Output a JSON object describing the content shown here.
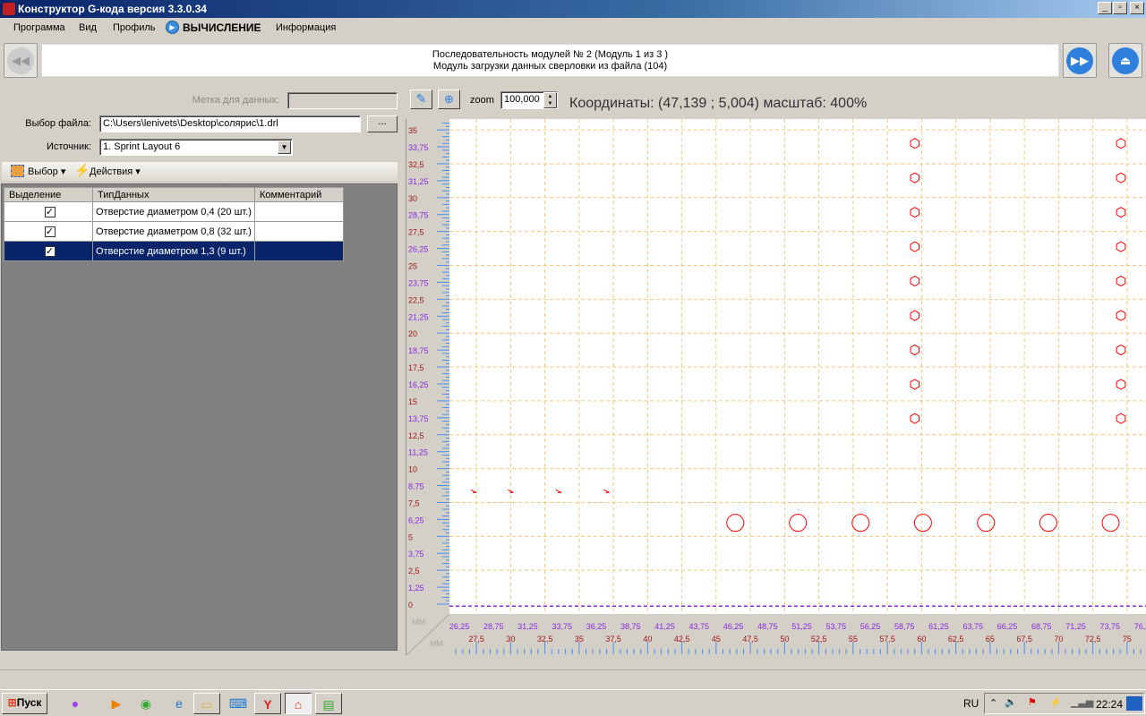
{
  "window": {
    "title": "Конструктор G-кода версия 3.3.0.34",
    "min": "_",
    "restore": "▫",
    "close": "×"
  },
  "menu": [
    "Программа",
    "Вид",
    "Профиль",
    "ВЫЧИСЛЕНИЕ",
    "Информация"
  ],
  "module": {
    "line1": "Последовательность модулей № 2 (Модуль 1 из 3 )",
    "line2": "Модуль загрузки данных сверловки из файла (104)"
  },
  "left": {
    "label_data": "Метка для данных:",
    "label_data_value": "",
    "file_label": "Выбор файла:",
    "file_value": "C:\\Users\\lenivets\\Desktop\\солярис\\1.drl",
    "browse": "...",
    "source_label": "Источник:",
    "source_value": "1. Sprint Layout 6",
    "toolbar": {
      "select": "Выбор",
      "actions": "Действия"
    },
    "table": {
      "headers": [
        "Выделение",
        "ТипДанных",
        "Комментарий"
      ],
      "rows": [
        {
          "checked": true,
          "type": "Отверстие диаметром 0,4 (20 шт.)",
          "comment": ""
        },
        {
          "checked": true,
          "type": "Отверстие диаметром 0,8 (32 шт.)",
          "comment": ""
        },
        {
          "checked": true,
          "type": "Отверстие диаметром 1,3 (9 шт.)",
          "comment": "",
          "selected": true
        }
      ]
    }
  },
  "view": {
    "zoom_label": "zoom",
    "zoom_value": "100,000",
    "coords": "Координаты: (47,139 ; 5,004) масштаб: 400%",
    "unit": "ММ."
  },
  "chart_data": {
    "type": "scatter",
    "xlim": [
      25.9,
      76.8
    ],
    "ylim": [
      -0.7,
      35.9
    ],
    "x_tick_step": 1.25,
    "y_tick_step": 1.25,
    "grid": true,
    "colors": {
      "holes": "#ff0000",
      "grid": "#f5c67a",
      "tick_primary": "#a01818",
      "tick_secondary": "#8a2be2"
    },
    "series": [
      {
        "marker": "hexagon",
        "points": [
          [
            59.5,
            34.0
          ],
          [
            59.5,
            31.46
          ],
          [
            59.5,
            28.92
          ],
          [
            59.5,
            26.38
          ],
          [
            59.5,
            23.84
          ],
          [
            59.5,
            21.3
          ],
          [
            59.5,
            18.76
          ],
          [
            59.5,
            16.22
          ],
          [
            59.5,
            13.7
          ],
          [
            74.55,
            34.0
          ],
          [
            74.55,
            31.46
          ],
          [
            74.55,
            28.92
          ],
          [
            74.55,
            26.38
          ],
          [
            74.55,
            23.84
          ],
          [
            74.55,
            21.3
          ],
          [
            74.55,
            18.76
          ],
          [
            74.55,
            16.22
          ],
          [
            74.55,
            13.7
          ]
        ]
      },
      {
        "marker": "circle",
        "points": [
          [
            46.4,
            6.0
          ],
          [
            50.97,
            6.0
          ],
          [
            55.55,
            6.0
          ],
          [
            60.1,
            6.0
          ],
          [
            64.7,
            6.0
          ],
          [
            69.25,
            6.0
          ],
          [
            73.8,
            6.0
          ]
        ]
      },
      {
        "marker": "tick",
        "points": [
          [
            27.3,
            8.3
          ],
          [
            30.0,
            8.3
          ],
          [
            33.5,
            8.3
          ],
          [
            37.0,
            8.3
          ]
        ]
      }
    ]
  },
  "taskbar": {
    "start": "Пуск",
    "lang": "RU",
    "clock": "22:24"
  }
}
